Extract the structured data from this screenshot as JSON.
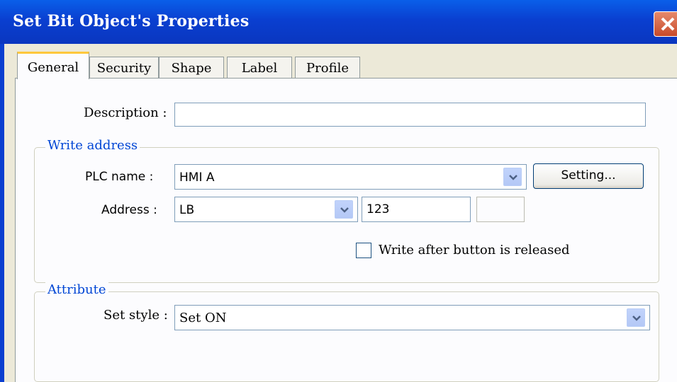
{
  "window": {
    "title": "Set Bit Object's Properties"
  },
  "tabs": [
    {
      "label": "General",
      "active": true
    },
    {
      "label": "Security",
      "active": false
    },
    {
      "label": "Shape",
      "active": false
    },
    {
      "label": "Label",
      "active": false
    },
    {
      "label": "Profile",
      "active": false
    }
  ],
  "general": {
    "description_label": "Description :",
    "description_value": "",
    "write_address": {
      "legend": "Write address",
      "plc_name_label": "PLC name :",
      "plc_name_value": "HMI A",
      "setting_button": "Setting...",
      "address_label": "Address :",
      "address_device": "LB",
      "address_value": "123",
      "checkbox_label": "Write after button is released",
      "checkbox_checked": false
    },
    "attribute": {
      "legend": "Attribute",
      "set_style_label": "Set style :",
      "set_style_value": "Set ON"
    }
  },
  "colors": {
    "titlebar": "#0a3fd0",
    "legend_text": "#0046d5",
    "active_tab_highlight": "#ffc83c",
    "close_button": "#c84a2a"
  }
}
